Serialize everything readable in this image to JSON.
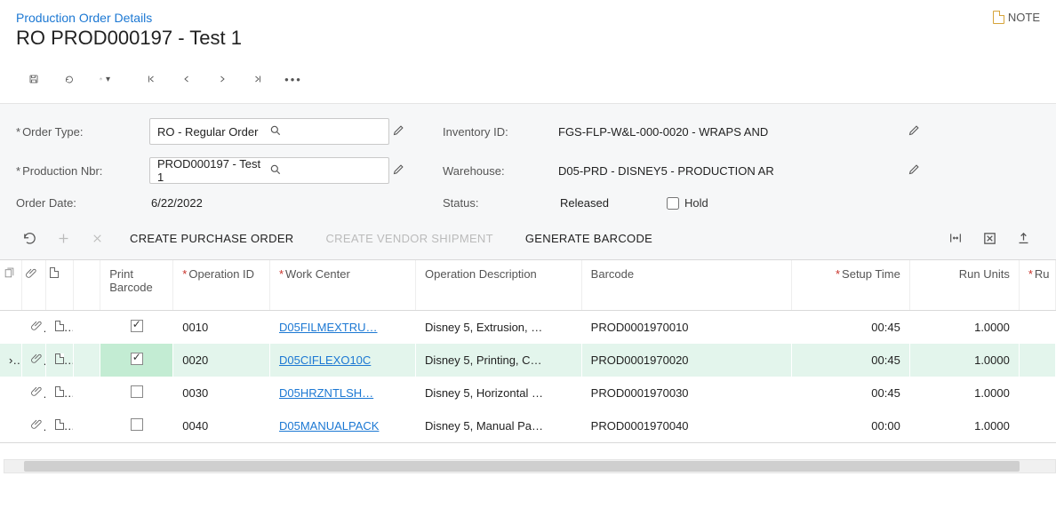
{
  "breadcrumb": {
    "label": "Production Order Details"
  },
  "page_title": "RO PROD000197 - Test 1",
  "note_label": "NOTE",
  "form": {
    "order_type_label": "Order Type:",
    "order_type_value": "RO - Regular Order",
    "production_nbr_label": "Production Nbr:",
    "production_nbr_value": "PROD000197 - Test 1",
    "order_date_label": "Order Date:",
    "order_date_value": "6/22/2022",
    "inventory_id_label": "Inventory ID:",
    "inventory_id_value": "FGS-FLP-W&L-000-0020 - WRAPS AND",
    "warehouse_label": "Warehouse:",
    "warehouse_value": "D05-PRD - DISNEY5 - PRODUCTION AR",
    "status_label": "Status:",
    "status_value": "Released",
    "hold_label": "Hold"
  },
  "grid_toolbar": {
    "create_po": "CREATE PURCHASE ORDER",
    "create_vs": "CREATE VENDOR SHIPMENT",
    "gen_barcode": "GENERATE BARCODE"
  },
  "columns": {
    "print_barcode": "Print Barcode",
    "operation_id": "Operation ID",
    "work_center": "Work Center",
    "op_desc": "Operation Description",
    "barcode": "Barcode",
    "setup_time": "Setup Time",
    "run_units": "Run Units",
    "run": "Ru"
  },
  "rows": [
    {
      "selected": false,
      "print": true,
      "op": "0010",
      "wc": "D05FILMEXTRU…",
      "desc": "Disney 5, Extrusion, …",
      "barcode": "PROD0001970010",
      "setup": "00:45",
      "units": "1.0000"
    },
    {
      "selected": true,
      "print": true,
      "op": "0020",
      "wc": "D05CIFLEXO10C",
      "desc": "Disney 5, Printing, C…",
      "barcode": "PROD0001970020",
      "setup": "00:45",
      "units": "1.0000"
    },
    {
      "selected": false,
      "print": false,
      "op": "0030",
      "wc": "D05HRZNTLSH…",
      "desc": "Disney 5, Horizontal …",
      "barcode": "PROD0001970030",
      "setup": "00:45",
      "units": "1.0000"
    },
    {
      "selected": false,
      "print": false,
      "op": "0040",
      "wc": "D05MANUALPACK",
      "desc": "Disney 5, Manual Pa…",
      "barcode": "PROD0001970040",
      "setup": "00:00",
      "units": "1.0000"
    }
  ]
}
